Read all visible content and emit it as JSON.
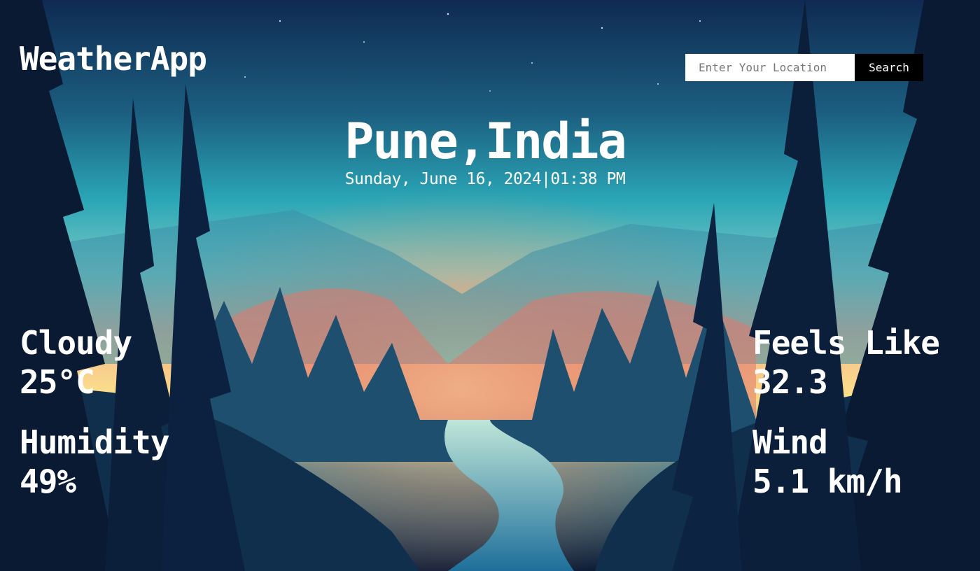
{
  "header": {
    "brand": "WeatherApp"
  },
  "search": {
    "placeholder": "Enter Your Location",
    "button_label": "Search"
  },
  "location": {
    "name": "Pune,India",
    "datetime": "Sunday, June 16, 2024|01:38 PM"
  },
  "weather": {
    "condition": "Cloudy",
    "temperature": "25°C",
    "humidity_label": "Humidity",
    "humidity_value": "49%",
    "feels_like_label": "Feels Like",
    "feels_like_value": "32.3",
    "wind_label": "Wind",
    "wind_value": "5.1 km/h"
  },
  "background": {
    "description_icon": "forest-sunset-landscape-image"
  }
}
